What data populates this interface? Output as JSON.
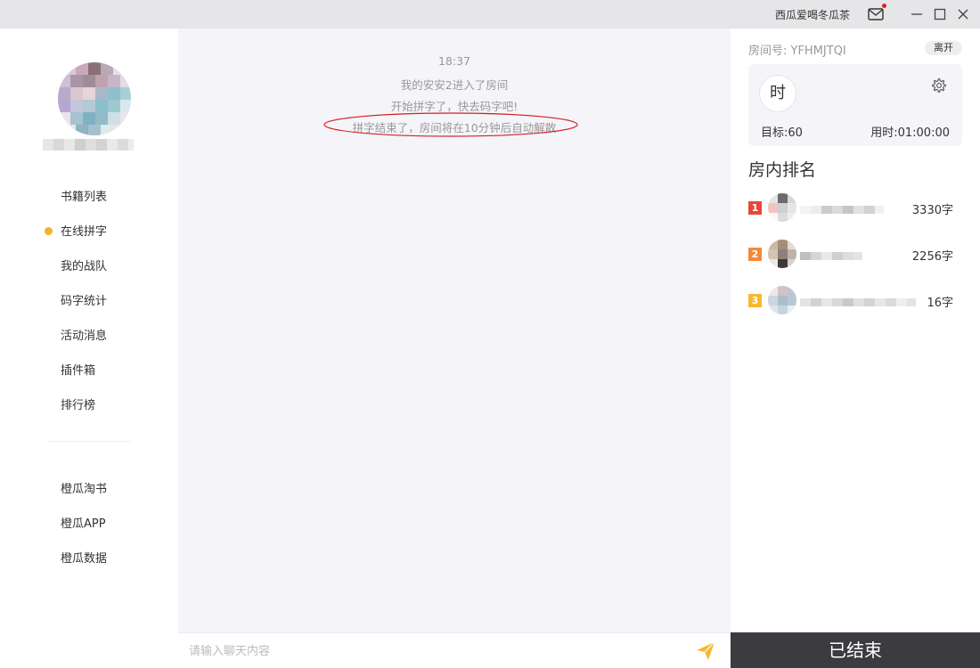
{
  "titlebar": {
    "username": "西瓜爱喝冬瓜茶",
    "icons": {
      "mail": "mail-icon",
      "minimize": "minimize-icon",
      "maximize": "maximize-icon",
      "close": "close-icon"
    }
  },
  "sidebar": {
    "nav": [
      {
        "label": "书籍列表",
        "active": false
      },
      {
        "label": "在线拼字",
        "active": true
      },
      {
        "label": "我的战队",
        "active": false
      },
      {
        "label": "码字统计",
        "active": false
      },
      {
        "label": "活动消息",
        "active": false
      },
      {
        "label": "插件箱",
        "active": false
      },
      {
        "label": "排行榜",
        "active": false
      }
    ],
    "links": [
      {
        "label": "橙瓜淘书"
      },
      {
        "label": "橙瓜APP"
      },
      {
        "label": "橙瓜数据"
      }
    ]
  },
  "chat": {
    "time": "18:37",
    "messages": [
      "我的安安2进入了房间",
      "开始拼字了，快去码字吧!",
      "拼字结束了，房间将在10分钟后自动解散"
    ],
    "input_placeholder": "请输入聊天内容"
  },
  "room": {
    "id_label": "房间号: YFHMJTQI",
    "leave_label": "离开",
    "timer_badge": "时",
    "target_label": "目标:60",
    "used_label": "用时:01:00:00",
    "ranking_title": "房内排名",
    "ranking": [
      {
        "rank": "1",
        "score": "3330字"
      },
      {
        "rank": "2",
        "score": "2256字"
      },
      {
        "rank": "3",
        "score": "16字"
      }
    ],
    "finish_label": "已结束"
  },
  "colors": {
    "accent": "#f0b429",
    "rank1": "#e8473a",
    "rank2": "#f3893a",
    "rank3": "#f5b92e",
    "highlight": "#d42222",
    "finish_bg": "#3c3c40"
  }
}
